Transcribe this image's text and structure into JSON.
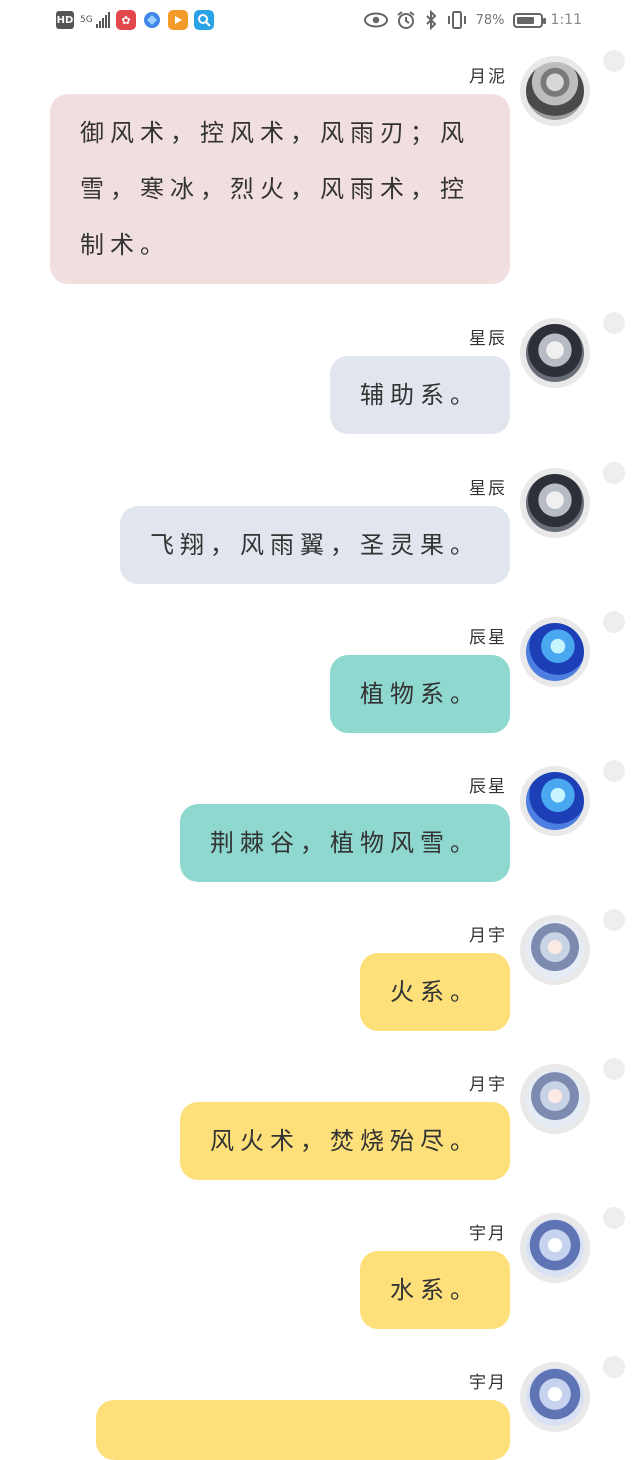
{
  "status_bar": {
    "hd_label": "HD",
    "network_label": "5G",
    "icons": [
      "hd-icon",
      "signal-icon",
      "kuaishou-icon",
      "browser-icon",
      "video-icon",
      "search-app-icon",
      "eye-icon",
      "alarm-icon",
      "bluetooth-icon",
      "vibrate-icon",
      "battery-icon"
    ],
    "battery": "78%",
    "battery_level": 0.78,
    "time": "1:11"
  },
  "messages": [
    {
      "sender": "月泥",
      "text": "御风术，控风术，风雨刃；风雪，寒冰，烈火，风雨术，控制术。",
      "color": "#f1dfe0",
      "avatar": "avatar-yueni"
    },
    {
      "sender": "星辰",
      "text": "辅助系。",
      "color": "#e1e6ee",
      "avatar": "avatar-xingchen"
    },
    {
      "sender": "星辰",
      "text": "飞翔，风雨翼，圣灵果。",
      "color": "#e1e6ee",
      "avatar": "avatar-xingchen"
    },
    {
      "sender": "辰星",
      "text": "植物系。",
      "color": "#8ed8cf",
      "avatar": "avatar-chenxing"
    },
    {
      "sender": "辰星",
      "text": "荆棘谷，植物风雪。",
      "color": "#8ed8cf",
      "avatar": "avatar-chenxing"
    },
    {
      "sender": "月宇",
      "text": "火系。",
      "color": "#fde07a",
      "avatar": "avatar-yueyu"
    },
    {
      "sender": "月宇",
      "text": "风火术，焚烧殆尽。",
      "color": "#fde07a",
      "avatar": "avatar-yueyu"
    },
    {
      "sender": "宇月",
      "text": "水系。",
      "color": "#fde07a",
      "avatar": "avatar-yuyue"
    },
    {
      "sender": "宇月",
      "text": "",
      "color": "#fde07a",
      "avatar": "avatar-yuyue"
    }
  ]
}
